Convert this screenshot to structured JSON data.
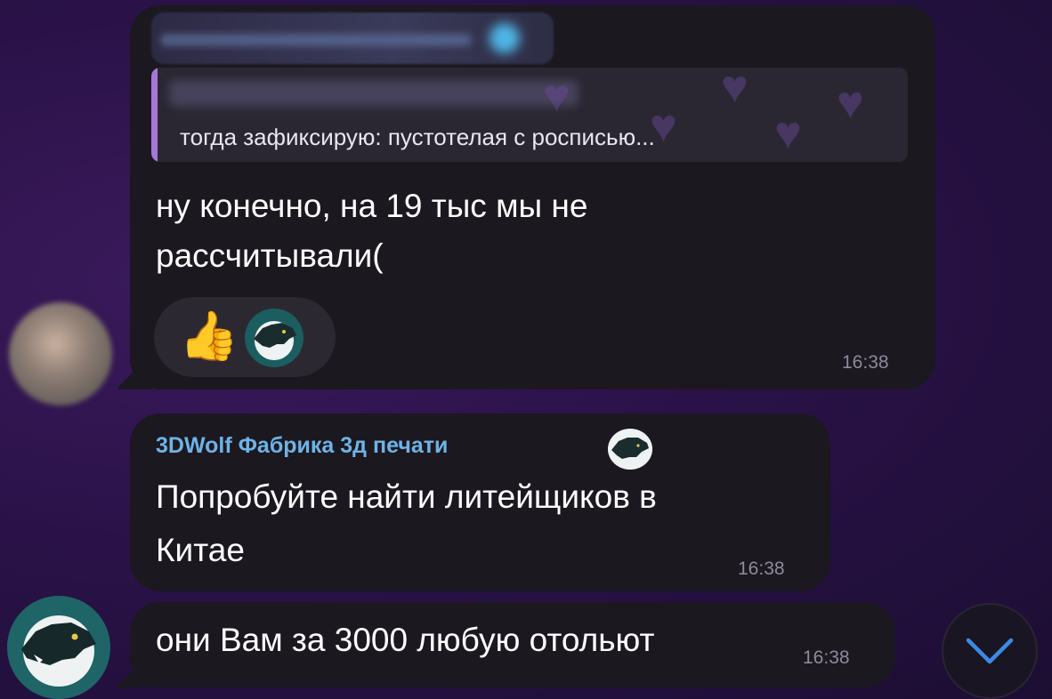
{
  "messages": [
    {
      "reply_preview": "тогда зафиксирую: пустотелая с росписью...",
      "lines": [
        "ну конечно, на 19 тыс мы не",
        "рассчитывали("
      ],
      "time": "16:38",
      "reactions": [
        "👍",
        "wolf-logo"
      ]
    },
    {
      "sender": "3DWolf Фабрика 3д печати",
      "lines": [
        "Попробуйте найти литейщиков в",
        "Китае"
      ],
      "time": "16:38"
    },
    {
      "lines": [
        "они Вам за 3000 любую отольют"
      ],
      "time": "16:38"
    }
  ],
  "colors": {
    "background": "#2a1248",
    "bubble": "#1b1820",
    "reply_accent": "#a777d8",
    "sender_name": "#6fb3e6",
    "time": "#8e8a9b"
  },
  "icons": {
    "scroll_down": "chevron-down-icon",
    "reaction_1": "thumbs-up-icon",
    "reaction_2": "wolf-logo-icon"
  }
}
